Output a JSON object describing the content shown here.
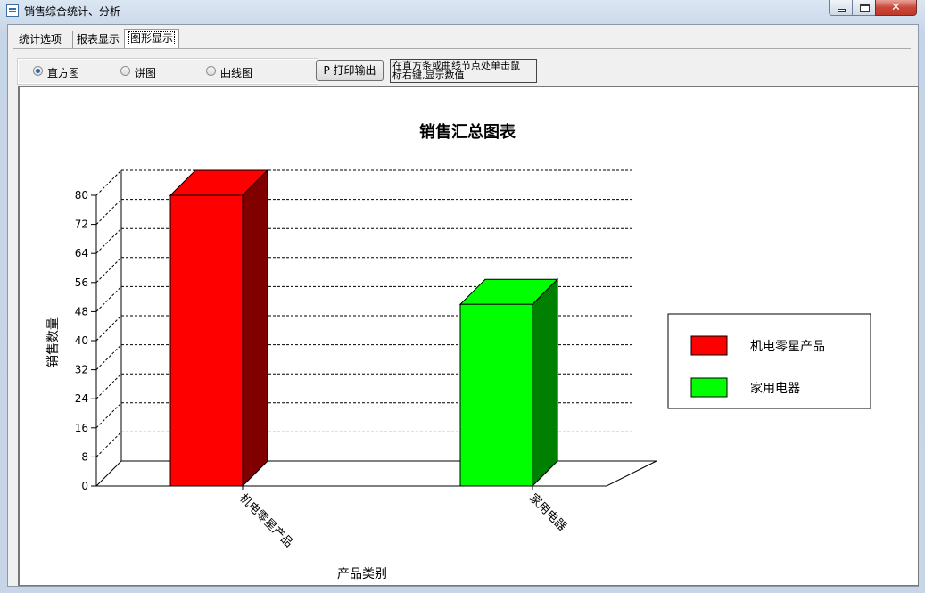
{
  "window": {
    "title": "销售综合统计、分析"
  },
  "tabs": [
    {
      "label": "统计选项"
    },
    {
      "label": "报表显示"
    },
    {
      "label": "图形显示"
    }
  ],
  "chart_types": [
    {
      "label": "直方图",
      "selected": true
    },
    {
      "label": "饼图",
      "selected": false
    },
    {
      "label": "曲线图",
      "selected": false
    }
  ],
  "print_button": {
    "label": "P 打印输出"
  },
  "hint_text": {
    "line1": "在直方条或曲线节点处单击鼠",
    "line2": "标右键,显示数值"
  },
  "chart_data": {
    "type": "bar",
    "title": "销售汇总图表",
    "xlabel": "产品类别",
    "ylabel": "销售数量",
    "categories": [
      "机电零星产品",
      "家用电器"
    ],
    "values": [
      80,
      50
    ],
    "colors": [
      "#ff0000",
      "#00ff00"
    ],
    "ylim": [
      0,
      80
    ],
    "yticks": [
      "0",
      "8",
      "16",
      "24",
      "32",
      "40",
      "48",
      "56",
      "64",
      "72",
      "80"
    ],
    "grid": true,
    "legend": {
      "placement": "right",
      "entries": [
        {
          "name": "机电零星产品",
          "color": "#ff0000"
        },
        {
          "name": "家用电器",
          "color": "#00ff00"
        }
      ]
    }
  }
}
